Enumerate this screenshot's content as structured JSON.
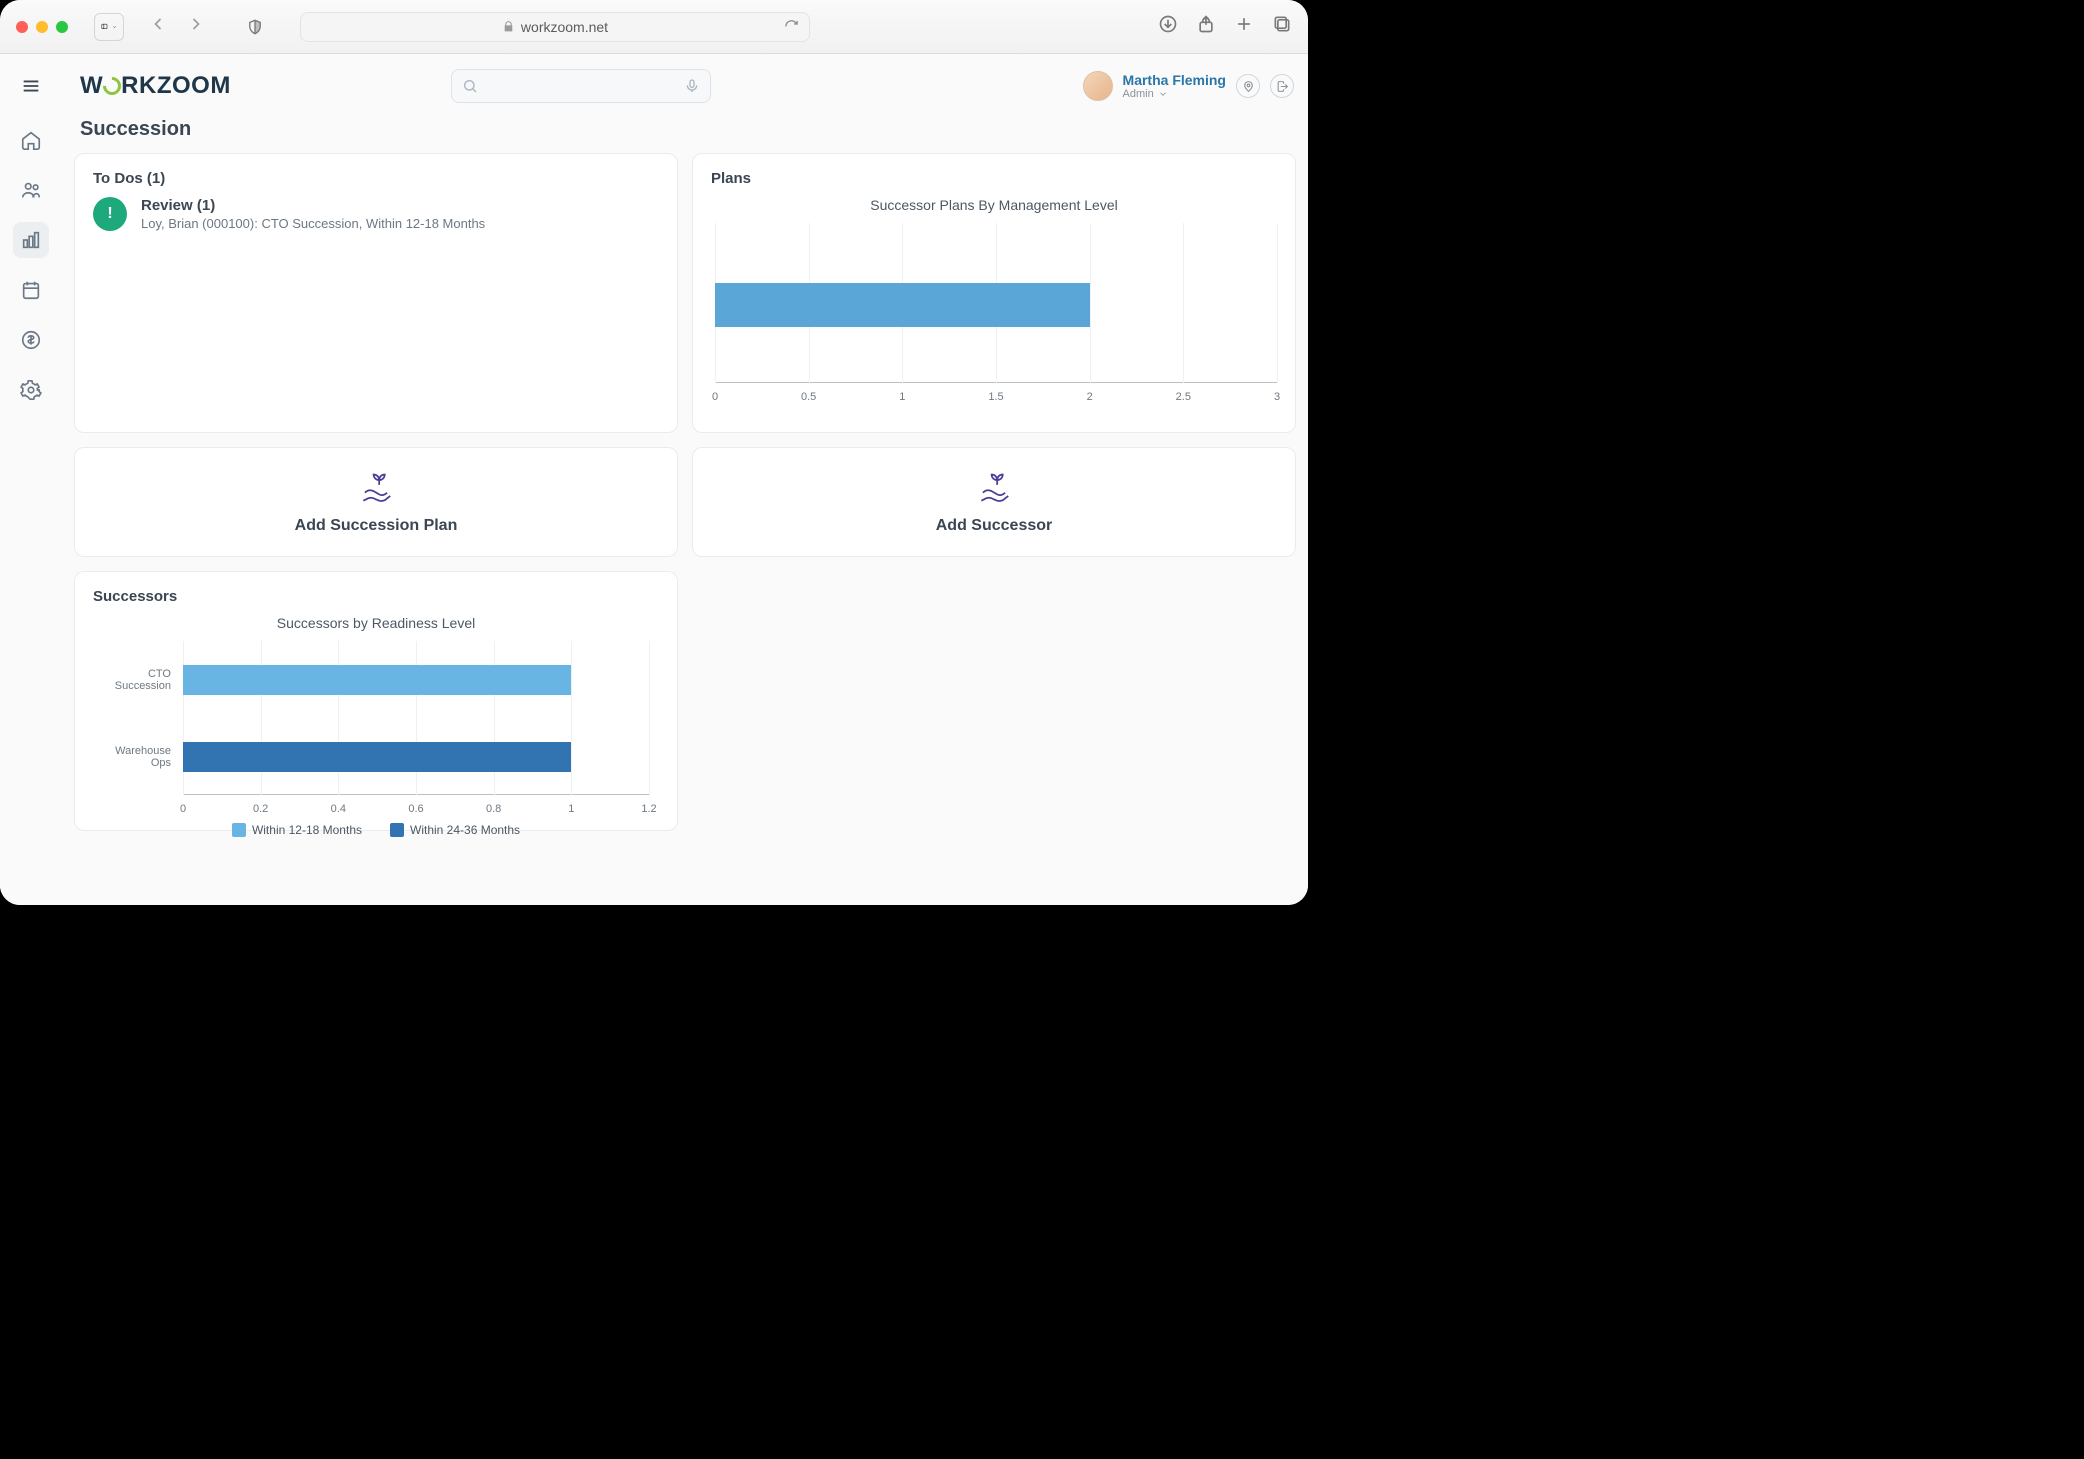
{
  "browser": {
    "url": "workzoom.net"
  },
  "logo_text_1": "W",
  "logo_text_2": "RKZOOM",
  "user": {
    "name": "Martha Fleming",
    "role": "Admin"
  },
  "page_title": "Succession",
  "todos": {
    "header": "To Dos (1)",
    "item_title": "Review (1)",
    "item_sub": "Loy, Brian (000100): CTO Succession, Within 12-18 Months"
  },
  "plans": {
    "header": "Plans"
  },
  "add_plan_label": "Add Succession Plan",
  "add_successor_label": "Add Successor",
  "successors_header": "Successors",
  "chart_data": [
    {
      "id": "plans_chart",
      "type": "bar",
      "orientation": "horizontal",
      "title": "Successor Plans By Management Level",
      "categories": [
        ""
      ],
      "values": [
        2
      ],
      "xlim": [
        0,
        3
      ],
      "x_ticks": [
        0,
        0.5,
        1,
        1.5,
        2,
        2.5,
        3
      ],
      "bar_color": "#5aa6d6"
    },
    {
      "id": "successors_chart",
      "type": "bar",
      "orientation": "horizontal",
      "title": "Successors by Readiness Level",
      "categories": [
        "CTO Succession",
        "Warehouse Ops"
      ],
      "series": [
        {
          "name": "Within 12-18 Months",
          "values": [
            1,
            0
          ],
          "color": "#68b4e2"
        },
        {
          "name": "Within 24-36 Months",
          "values": [
            0,
            1
          ],
          "color": "#3273b1"
        }
      ],
      "xlim": [
        0,
        1.2
      ],
      "x_ticks": [
        0,
        0.2,
        0.4,
        0.6,
        0.8,
        1,
        1.2
      ]
    }
  ]
}
